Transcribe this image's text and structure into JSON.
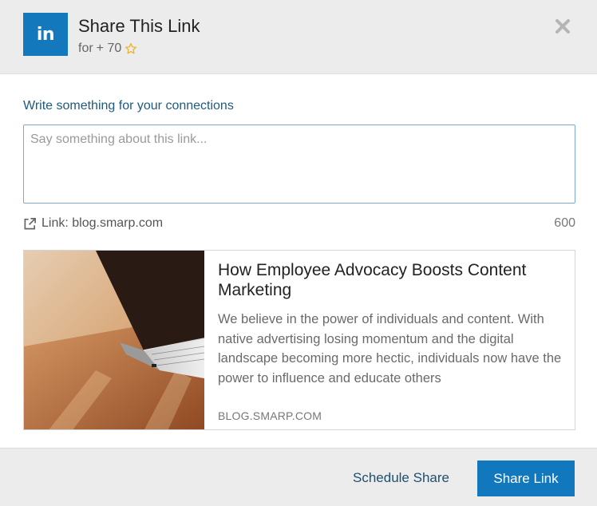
{
  "header": {
    "logo_text": "in",
    "title": "Share This Link",
    "subtitle_prefix": "for",
    "points": "+ 70",
    "star_icon": "star-outline-icon",
    "close_icon": "close-icon"
  },
  "compose": {
    "prompt": "Write something for your connections",
    "placeholder": "Say something about this link...",
    "value": ""
  },
  "link": {
    "label": "Link: blog.smarp.com",
    "char_count": "600",
    "icon": "external-link-icon"
  },
  "preview": {
    "title": "How Employee Advocacy Boosts Content Marketing",
    "description": "We believe in the power of individuals and content. With native advertising losing momentum and the digital landscape becoming more hectic, individuals now have the power to influence and educate others",
    "domain": "BLOG.SMARP.COM"
  },
  "footer": {
    "schedule_label": "Schedule Share",
    "share_label": "Share Link"
  },
  "colors": {
    "linkedin_blue": "#1478bd",
    "header_bg": "#ececec",
    "prompt_text": "#1e5a7e",
    "star": "#f0b429"
  }
}
